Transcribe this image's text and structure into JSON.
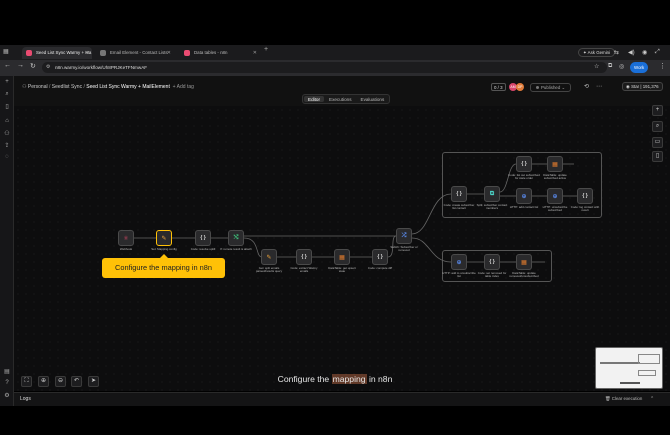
{
  "browser": {
    "tabs": [
      {
        "title": "Seed List Sync Warmy + Ma",
        "fav_color": "#ea4b71",
        "active": true
      },
      {
        "title": "Email Element - Contact Lists",
        "fav_color": "#777777",
        "active": false
      },
      {
        "title": "Data tables - n8n",
        "fav_color": "#ea4b71",
        "active": false
      }
    ],
    "new_tab": "+",
    "ask_gemini": "Ask Gemini",
    "url": "n8n.warmy.io/workflow/Uh8PRJKeTFNmwAF",
    "profile_label": "Work"
  },
  "header": {
    "crumb_personal": "Personal",
    "crumb_project": "Seedlist Sync",
    "workflow_title": "Seed List Sync Warmy + MailElement",
    "add_tag": "+ Add tag",
    "counter": "0 / 3",
    "avatars": [
      {
        "initials": "AM",
        "color": "#d6456b"
      },
      {
        "initials": "DP",
        "color": "#e07b39"
      }
    ],
    "published": "Published",
    "star_label": "Star",
    "star_count": "191,376",
    "mode_tabs": [
      "Editor",
      "Executions",
      "Evaluations"
    ],
    "active_mode": "Editor"
  },
  "nodes": [
    {
      "id": "webhook",
      "label": "Webhook",
      "glyph": "⚛",
      "color": "#e24b6a"
    },
    {
      "id": "set-config",
      "label": "Set: Mapping config",
      "glyph": "✎",
      "color": "#f0a63b"
    },
    {
      "id": "code-resolve",
      "label": "Code: resolve uptill",
      "glyph": "{ }",
      "color": "#dddddd"
    },
    {
      "id": "if-remote",
      "label": "If: remote result is attach",
      "glyph": "⤭",
      "color": "#3ec07a"
    },
    {
      "id": "get-emails",
      "label": "Get: split emails parsed/results query",
      "glyph": "✎",
      "color": "#f0a63b"
    },
    {
      "id": "code-extract",
      "label": "Code: extract Warmy emails",
      "glyph": "{ }",
      "color": "#dddddd"
    },
    {
      "id": "dt-upsert",
      "label": "DataTable: get upsert state",
      "glyph": "▦",
      "color": "#e67e2e"
    },
    {
      "id": "code-diff",
      "label": "Code: compute diff",
      "glyph": "{ }",
      "color": "#dddddd"
    },
    {
      "id": "switch",
      "label": "Switch: Subscriber or removed",
      "glyph": "⤮",
      "color": "#5b8cf0"
    },
    {
      "id": "code-subscriber",
      "label": "Code: create subscriber list contact",
      "glyph": "{ }",
      "color": "#dddddd"
    },
    {
      "id": "split",
      "label": "Split: subscriber contact members",
      "glyph": "⧉",
      "color": "#4bd2c6"
    },
    {
      "id": "code-list",
      "label": "Code: list out subscribed for state order",
      "glyph": "{ }",
      "color": "#dddddd"
    },
    {
      "id": "dt-update",
      "label": "DataTable: update subscribed active",
      "glyph": "▦",
      "color": "#e67e2e"
    },
    {
      "id": "http-contact",
      "label": "HTTP: add contact list",
      "glyph": "⊕",
      "color": "#5b8cf0"
    },
    {
      "id": "http-unsub",
      "label": "HTTP: unsubscribe subscribed",
      "glyph": "⊕",
      "color": "#5b8cf0"
    },
    {
      "id": "code-log",
      "label": "Code: log contact with result",
      "glyph": "{ }",
      "color": "#dddddd"
    },
    {
      "id": "http-unsub2",
      "label": "HTTP: add to unsubscribe list",
      "glyph": "⊕",
      "color": "#5b8cf0"
    },
    {
      "id": "code-removed",
      "label": "Code: set removed for table index",
      "glyph": "{ }",
      "color": "#dddddd"
    },
    {
      "id": "dt-removed",
      "label": "DataTable: update removed/unsubscribed",
      "glyph": "▦",
      "color": "#e67e2e"
    }
  ],
  "tooltip": "Configure the mapping in n8n",
  "caption": {
    "prefix": "Configure the ",
    "highlight": "mapping",
    "suffix": " in n8n"
  },
  "logs": {
    "label": "Logs",
    "clear": "Clear execution"
  }
}
